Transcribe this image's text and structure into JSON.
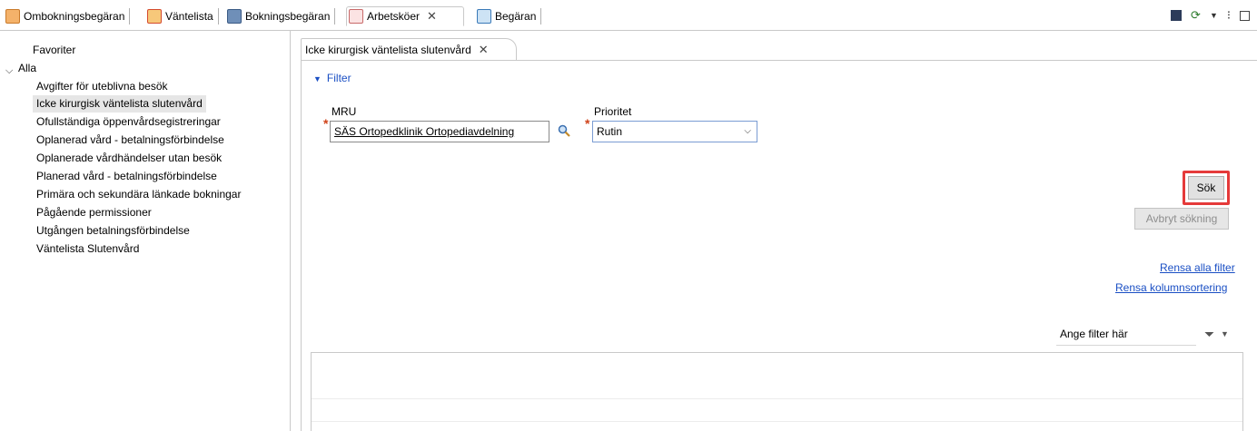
{
  "top_tabs": [
    {
      "label": "Ombokningsbegäran",
      "icon": "calendar-edit-icon"
    },
    {
      "label": "Väntelista",
      "icon": "calendar-list-icon"
    },
    {
      "label": "Bokningsbegäran",
      "icon": "booking-icon"
    },
    {
      "label": "Arbetsköer",
      "icon": "workqueue-icon",
      "active": true
    },
    {
      "label": "Begäran",
      "icon": "search-doc-icon"
    }
  ],
  "tree": {
    "favorites": "Favoriter",
    "all": "Alla",
    "items": [
      "Avgifter för uteblivna besök",
      "Icke kirurgisk väntelista slutenvård",
      "Ofullständiga öppenvårdsegistreringar",
      "Oplanerad vård - betalningsförbindelse",
      "Oplanerade vårdhändelser utan besök",
      "Planerad vård - betalningsförbindelse",
      "Primära och sekundära länkade bokningar",
      "Pågående permissioner",
      "Utgången betalningsförbindelse",
      "Väntelista Slutenvård"
    ],
    "selected_index": 1
  },
  "content": {
    "tab_label": "Icke kirurgisk väntelista slutenvård",
    "filter_label": "Filter",
    "mru": {
      "label": "MRU",
      "value": "SÄS Ortopedklinik Ortopediavdelning"
    },
    "prioritet": {
      "label": "Prioritet",
      "value": "Rutin"
    },
    "search_button": "Sök",
    "cancel_button": "Avbryt sökning",
    "clear_filters": "Rensa alla filter",
    "clear_sorting": "Rensa kolumnsortering",
    "filter_input_placeholder": "Ange filter här"
  },
  "colors": {
    "accent": "#1a4fc4",
    "highlight": "#e53a3a",
    "required": "#d0431a"
  }
}
